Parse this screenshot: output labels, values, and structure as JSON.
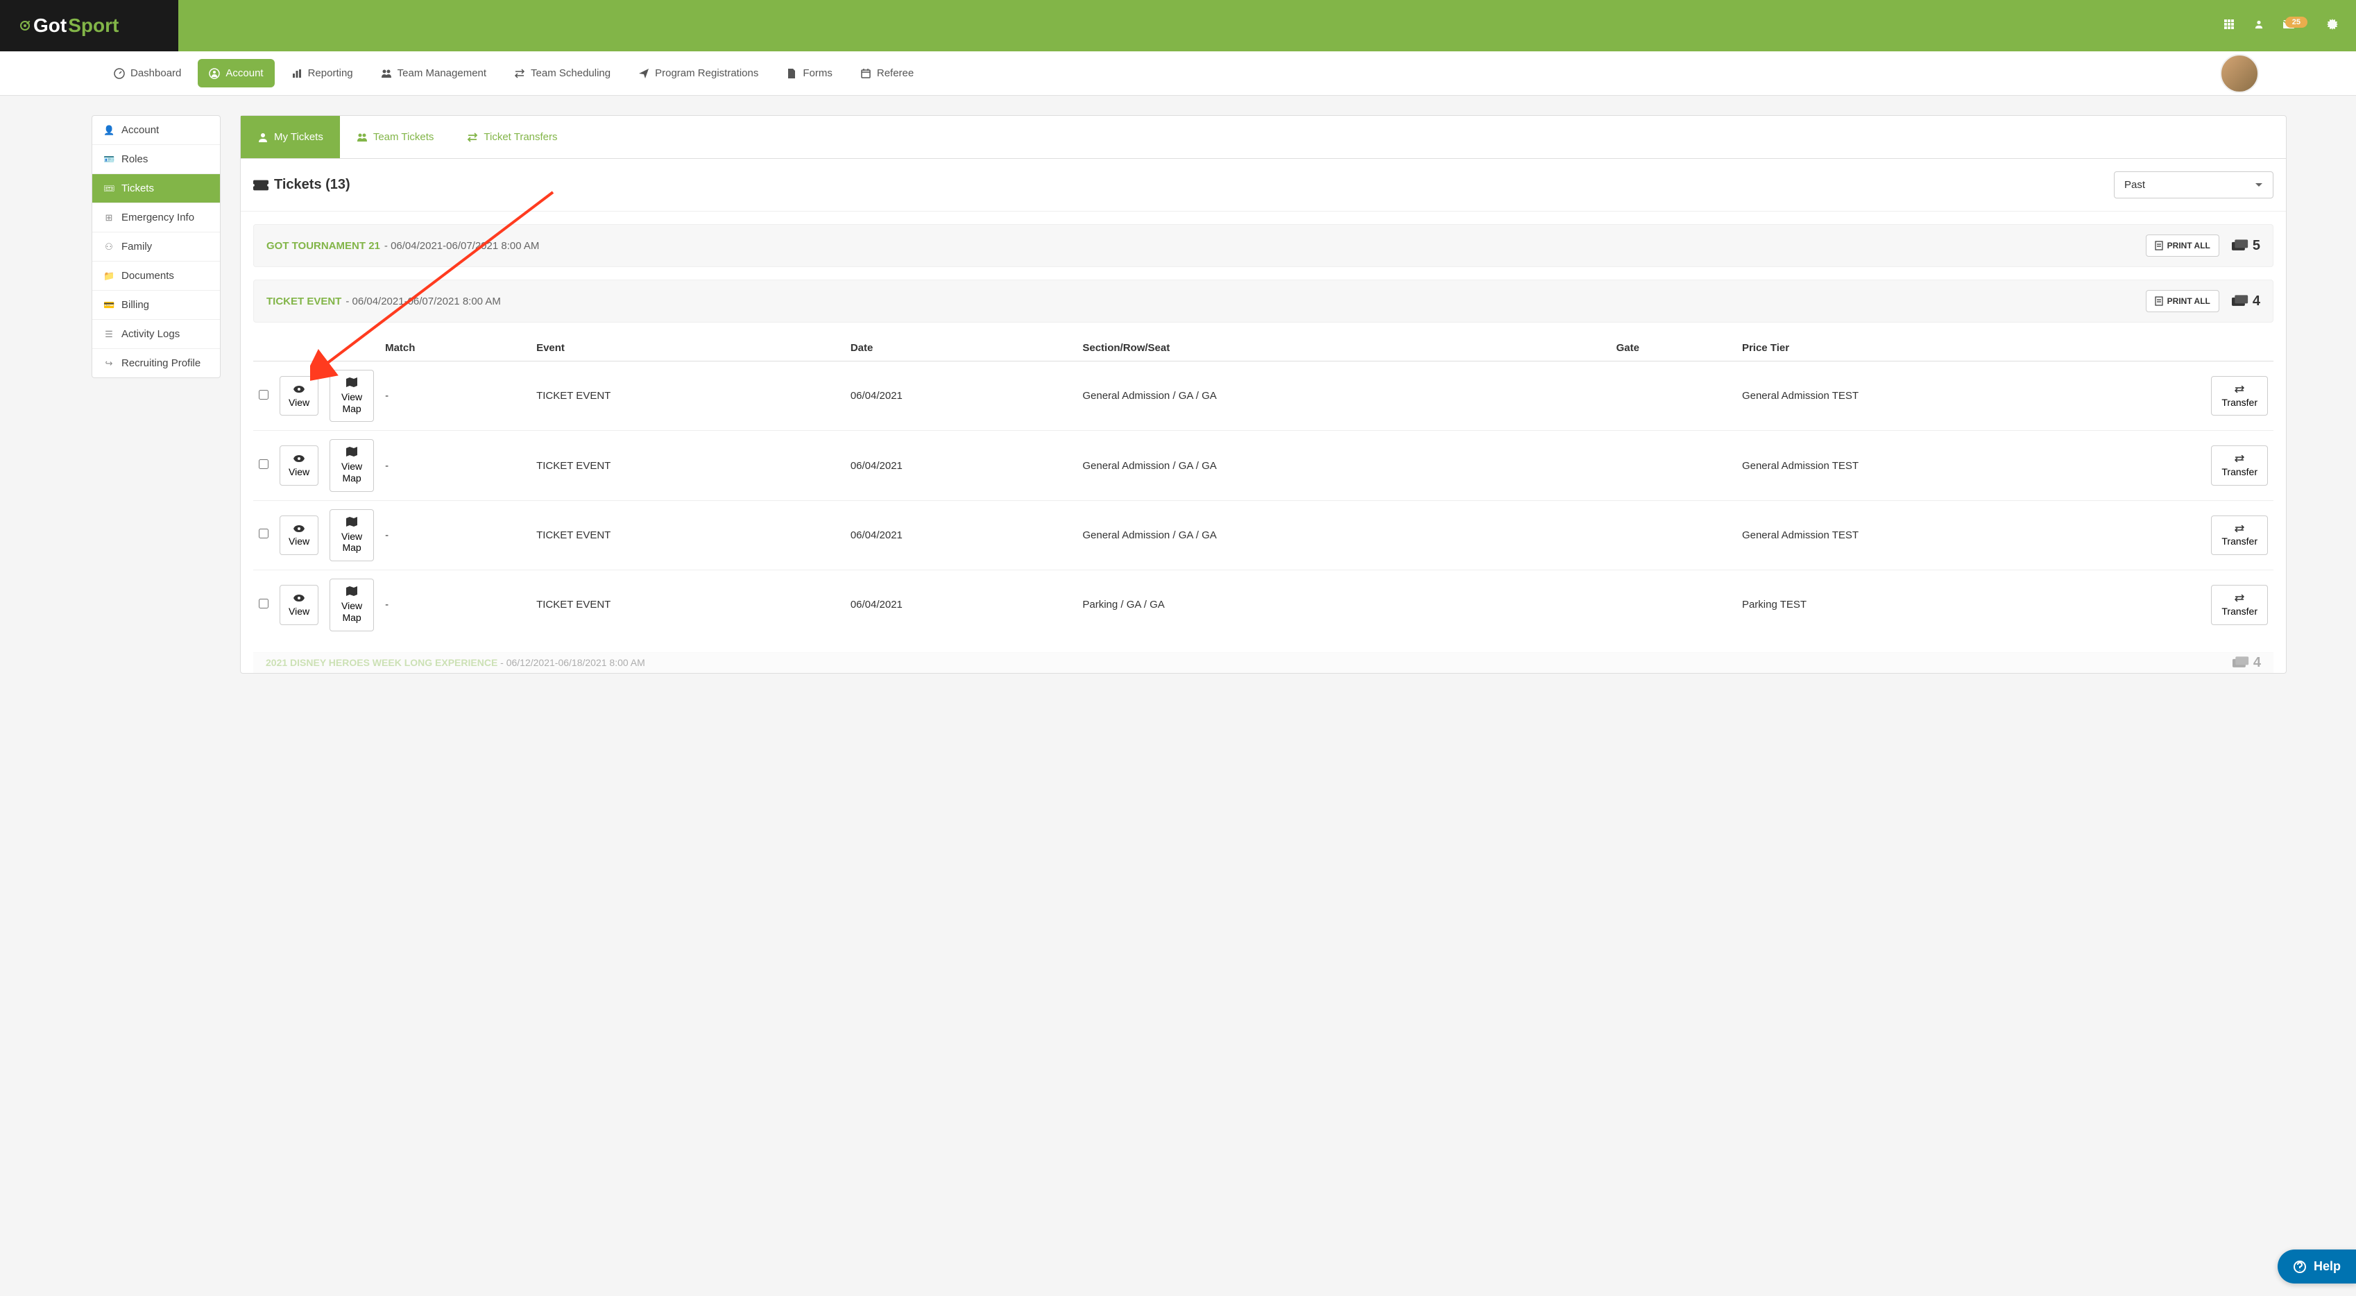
{
  "logo": {
    "part1": "Got",
    "part2": "Sport"
  },
  "topbar": {
    "notification_count": "25"
  },
  "mainnav": {
    "items": [
      {
        "label": "Dashboard"
      },
      {
        "label": "Account"
      },
      {
        "label": "Reporting"
      },
      {
        "label": "Team Management"
      },
      {
        "label": "Team Scheduling"
      },
      {
        "label": "Program Registrations"
      },
      {
        "label": "Forms"
      },
      {
        "label": "Referee"
      }
    ]
  },
  "sidebar": {
    "items": [
      {
        "label": "Account"
      },
      {
        "label": "Roles"
      },
      {
        "label": "Tickets"
      },
      {
        "label": "Emergency Info"
      },
      {
        "label": "Family"
      },
      {
        "label": "Documents"
      },
      {
        "label": "Billing"
      },
      {
        "label": "Activity Logs"
      },
      {
        "label": "Recruiting Profile"
      }
    ]
  },
  "tabs": {
    "items": [
      {
        "label": "My Tickets"
      },
      {
        "label": "Team Tickets"
      },
      {
        "label": "Ticket Transfers"
      }
    ]
  },
  "heading": "Tickets (13)",
  "filter_selected": "Past",
  "events": [
    {
      "name": "GOT TOURNAMENT 21",
      "daterange": "- 06/04/2021-06/07/2021 8:00 AM",
      "print_label": "PRINT ALL",
      "count": "5"
    },
    {
      "name": "TICKET EVENT",
      "daterange": "- 06/04/2021-06/07/2021 8:00 AM",
      "print_label": "PRINT ALL",
      "count": "4"
    }
  ],
  "table": {
    "headers": {
      "match": "Match",
      "event": "Event",
      "date": "Date",
      "section": "Section/Row/Seat",
      "gate": "Gate",
      "price": "Price Tier"
    },
    "view_label": "View",
    "view_map_label": "View Map",
    "transfer_label": "Transfer",
    "rows": [
      {
        "match": "-",
        "event": "TICKET EVENT",
        "date": "06/04/2021",
        "section": "General Admission / GA / GA",
        "gate": "",
        "price": "General Admission TEST"
      },
      {
        "match": "-",
        "event": "TICKET EVENT",
        "date": "06/04/2021",
        "section": "General Admission / GA / GA",
        "gate": "",
        "price": "General Admission TEST"
      },
      {
        "match": "-",
        "event": "TICKET EVENT",
        "date": "06/04/2021",
        "section": "General Admission / GA / GA",
        "gate": "",
        "price": "General Admission TEST"
      },
      {
        "match": "-",
        "event": "TICKET EVENT",
        "date": "06/04/2021",
        "section": "Parking / GA / GA",
        "gate": "",
        "price": "Parking TEST"
      }
    ]
  },
  "bottom_partial": {
    "name": "2021 DISNEY HEROES WEEK LONG EXPERIENCE",
    "daterange": "- 06/12/2021-06/18/2021 8:00 AM",
    "count": "4"
  },
  "help_label": "Help"
}
